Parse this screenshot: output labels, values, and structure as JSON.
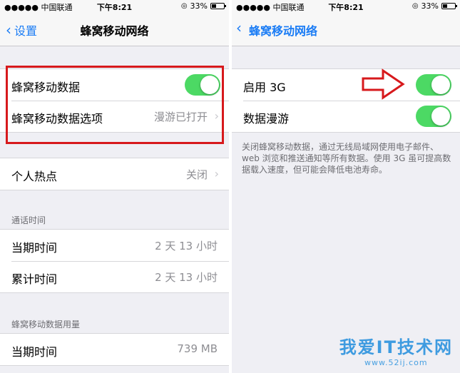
{
  "status": {
    "carrier": "●●●●● 中国联通",
    "time": "下午8:21",
    "battery": "33%",
    "battery_level": 0.33
  },
  "left": {
    "nav": {
      "back_label": "设置",
      "title": "蜂窝移动网络"
    },
    "rows1": [
      {
        "label": "蜂窝移动数据",
        "toggle": true
      },
      {
        "label": "蜂窝移动数据选项",
        "value": "漫游已打开"
      }
    ],
    "hotspot": {
      "label": "个人热点",
      "value": "关闭"
    },
    "call_time": {
      "header": "通话时间",
      "rows": [
        {
          "label": "当期时间",
          "value": "2 天 13 小时"
        },
        {
          "label": "累计时间",
          "value": "2 天 13 小时"
        }
      ]
    },
    "usage": {
      "header": "蜂窝移动数据用量",
      "rows": [
        {
          "label": "当期时间",
          "value": "739 MB"
        }
      ]
    }
  },
  "right": {
    "nav": {
      "title": "蜂窝移动网络"
    },
    "rows": [
      {
        "label": "启用 3G",
        "toggle": true
      },
      {
        "label": "数据漫游",
        "toggle": true
      }
    ],
    "note": "关闭蜂窝移动数据，通过无线局域网使用电子邮件、web 浏览和推送通知等所有数据。使用 3G 虽可提高数据载入速度，但可能会降低电池寿命。"
  },
  "watermark": {
    "title": "我爱IT技术网",
    "url": "www.52ij.com"
  },
  "colors": {
    "accent": "#1a7cf5",
    "toggle_on": "#4cd964",
    "annotation": "#d7191c"
  }
}
